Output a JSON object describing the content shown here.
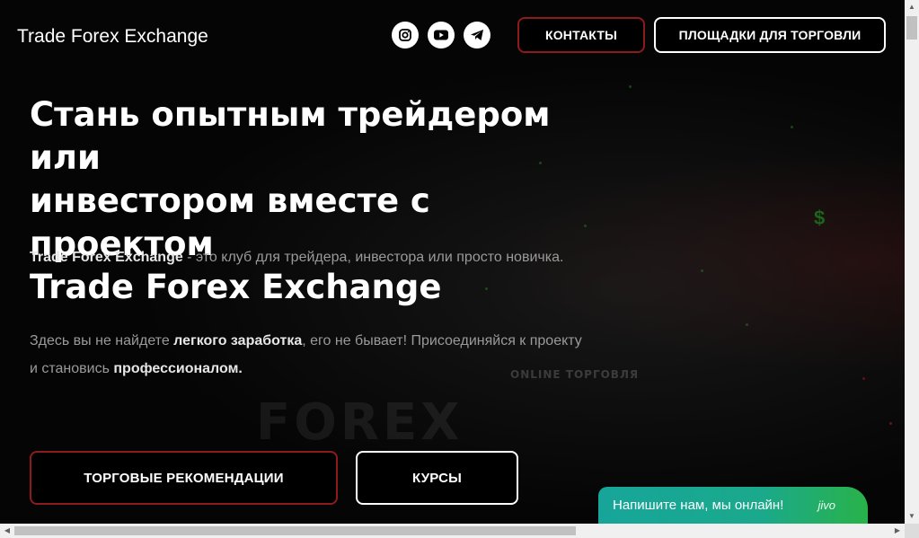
{
  "header": {
    "logo": "Trade Forex Exchange",
    "social": [
      "instagram-icon",
      "youtube-icon",
      "telegram-icon"
    ],
    "contacts_label": "КОНТАКТЫ",
    "platforms_label": "ПЛОЩАДКИ ДЛЯ ТОРГОВЛИ"
  },
  "hero": {
    "headline_1": "Стань опытным трейдером или",
    "headline_2": "инвестором вместе с проектом",
    "headline_3": "Trade Forex Exchange",
    "p1_bold": "Trade Forex Exchange",
    "p1_text": " - это клуб для трейдера, инвестора или просто новичка.",
    "p2_a": "Здесь вы не найдете ",
    "p2_bold1": "легкого заработка",
    "p2_b": ", его не бывает! Присоединяйся к проекту и становись ",
    "p2_bold2": "профессионалом.",
    "bg_word_1": "FOREX",
    "bg_word_2": "ONLINE ТОРГОВЛЯ",
    "btn_recommendations": "ТОРГОВЫЕ РЕКОМЕНДАЦИИ",
    "btn_courses": "КУРСЫ"
  },
  "chat": {
    "text": "Напишите нам, мы онлайн!",
    "brand": "jivo"
  },
  "colors": {
    "accent_red": "#8e1b1b",
    "chat_green": "#1aa98c"
  }
}
